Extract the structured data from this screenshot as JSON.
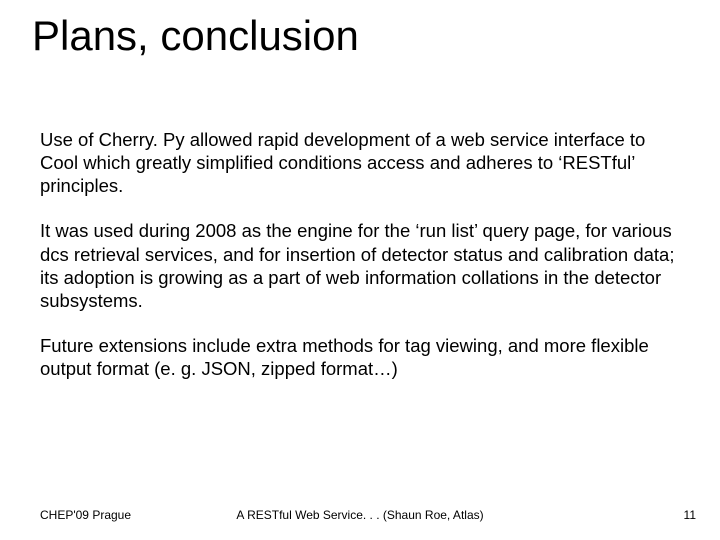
{
  "title": "Plans, conclusion",
  "paragraphs": {
    "p1": "Use of Cherry. Py allowed rapid development of a web service interface to Cool which greatly simplified conditions access and adheres to ‘RESTful’ principles.",
    "p2": "It was used during 2008 as the engine for the ‘run list’ query page, for various dcs retrieval services, and for insertion of detector status and calibration data; its adoption is growing as a part of web information collations in the detector subsystems.",
    "p3": "Future extensions include extra methods for tag viewing, and more flexible output format (e. g. JSON, zipped format…)"
  },
  "footer": {
    "left": "CHEP'09 Prague",
    "center": "A RESTful Web Service. . . (Shaun Roe, Atlas)",
    "page": "11"
  }
}
